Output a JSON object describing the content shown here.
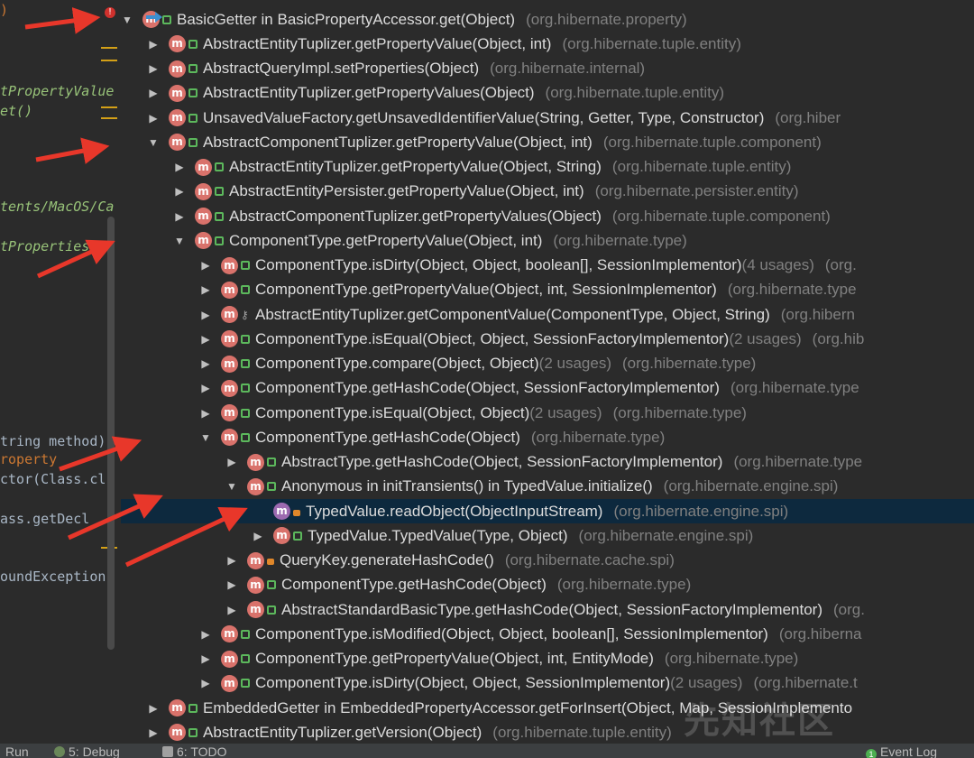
{
  "editor": {
    "lines": [
      {
        "text": ")",
        "cls": "c-orange"
      },
      {
        "text": "tPropertyValue",
        "cls": "c-green"
      },
      {
        "text": "et()",
        "cls": "c-green"
      },
      {
        "text": "tents/MacOS/Ca",
        "cls": "c-green"
      },
      {
        "text": "tProperties",
        "cls": "c-green"
      },
      {
        "text": "tring method)",
        "cls": "c-gray"
      },
      {
        "text": "roperty",
        "cls": "c-orange"
      },
      {
        "text": "ctor(Class.cl",
        "cls": "c-gray"
      },
      {
        "text": "ass.getDecl",
        "cls": "c-gray"
      },
      {
        "text": "oundException",
        "cls": "c-gray"
      }
    ],
    "error_badge": "!"
  },
  "hierarchy": {
    "rows": [
      {
        "label": "BasicGetter in BasicPropertyAccessor.get(Object)",
        "pkg": "(org.hibernate.property)",
        "usage": "",
        "level": 0,
        "arrow": "down",
        "vis": "pub"
      },
      {
        "label": "AbstractEntityTuplizer.getPropertyValue(Object, int)",
        "pkg": "(org.hibernate.tuple.entity)",
        "usage": "",
        "level": 1,
        "arrow": "right",
        "vis": "pub"
      },
      {
        "label": "AbstractQueryImpl.setProperties(Object)",
        "pkg": "(org.hibernate.internal)",
        "usage": "",
        "level": 1,
        "arrow": "right",
        "vis": "pub"
      },
      {
        "label": "AbstractEntityTuplizer.getPropertyValues(Object)",
        "pkg": "(org.hibernate.tuple.entity)",
        "usage": "",
        "level": 1,
        "arrow": "right",
        "vis": "pub"
      },
      {
        "label": "UnsavedValueFactory.getUnsavedIdentifierValue(String, Getter, Type, Constructor)",
        "pkg": "(org.hiber",
        "usage": "",
        "level": 1,
        "arrow": "right",
        "vis": "pub"
      },
      {
        "label": "AbstractComponentTuplizer.getPropertyValue(Object, int)",
        "pkg": "(org.hibernate.tuple.component)",
        "usage": "",
        "level": 1,
        "arrow": "down",
        "vis": "pub"
      },
      {
        "label": "AbstractEntityTuplizer.getPropertyValue(Object, String)",
        "pkg": "(org.hibernate.tuple.entity)",
        "usage": "",
        "level": 2,
        "arrow": "right",
        "vis": "pub"
      },
      {
        "label": "AbstractEntityPersister.getPropertyValue(Object, int)",
        "pkg": "(org.hibernate.persister.entity)",
        "usage": "",
        "level": 2,
        "arrow": "right",
        "vis": "pub"
      },
      {
        "label": "AbstractComponentTuplizer.getPropertyValues(Object)",
        "pkg": "(org.hibernate.tuple.component)",
        "usage": "",
        "level": 2,
        "arrow": "right",
        "vis": "pub"
      },
      {
        "label": "ComponentType.getPropertyValue(Object, int)",
        "pkg": "(org.hibernate.type)",
        "usage": "",
        "level": 2,
        "arrow": "down",
        "vis": "pub"
      },
      {
        "label": "ComponentType.isDirty(Object, Object, boolean[], SessionImplementor)",
        "pkg": "(org.",
        "usage": "(4 usages)",
        "level": 3,
        "arrow": "right",
        "vis": "pub"
      },
      {
        "label": "ComponentType.getPropertyValue(Object, int, SessionImplementor)",
        "pkg": "(org.hibernate.type",
        "usage": "",
        "level": 3,
        "arrow": "right",
        "vis": "pub"
      },
      {
        "label": "AbstractEntityTuplizer.getComponentValue(ComponentType, Object, String)",
        "pkg": "(org.hibern",
        "usage": "",
        "level": 3,
        "arrow": "right",
        "vis": "key"
      },
      {
        "label": "ComponentType.isEqual(Object, Object, SessionFactoryImplementor)",
        "pkg": "(org.hib",
        "usage": "(2 usages)",
        "level": 3,
        "arrow": "right",
        "vis": "pub"
      },
      {
        "label": "ComponentType.compare(Object, Object)",
        "pkg": "(org.hibernate.type)",
        "usage": "(2 usages)",
        "level": 3,
        "arrow": "right",
        "vis": "pub"
      },
      {
        "label": "ComponentType.getHashCode(Object, SessionFactoryImplementor)",
        "pkg": "(org.hibernate.type",
        "usage": "",
        "level": 3,
        "arrow": "right",
        "vis": "pub"
      },
      {
        "label": "ComponentType.isEqual(Object, Object)",
        "pkg": "(org.hibernate.type)",
        "usage": "(2 usages)",
        "level": 3,
        "arrow": "right",
        "vis": "pub"
      },
      {
        "label": "ComponentType.getHashCode(Object)",
        "pkg": "(org.hibernate.type)",
        "usage": "",
        "level": 3,
        "arrow": "down",
        "vis": "pub"
      },
      {
        "label": "AbstractType.getHashCode(Object, SessionFactoryImplementor)",
        "pkg": "(org.hibernate.type",
        "usage": "",
        "level": 4,
        "arrow": "right",
        "vis": "pub"
      },
      {
        "label": "Anonymous in initTransients() in TypedValue.initialize()",
        "pkg": "(org.hibernate.engine.spi)",
        "usage": "",
        "level": 4,
        "arrow": "down",
        "vis": "pub"
      },
      {
        "label": "TypedValue.readObject(ObjectInputStream)",
        "pkg": "(org.hibernate.engine.spi)",
        "usage": "",
        "level": 5,
        "arrow": "none",
        "vis": "lock",
        "selected": true
      },
      {
        "label": "TypedValue.TypedValue(Type, Object)",
        "pkg": "(org.hibernate.engine.spi)",
        "usage": "",
        "level": 5,
        "arrow": "right",
        "vis": "pub"
      },
      {
        "label": "QueryKey.generateHashCode()",
        "pkg": "(org.hibernate.cache.spi)",
        "usage": "",
        "level": 4,
        "arrow": "right",
        "vis": "lock"
      },
      {
        "label": "ComponentType.getHashCode(Object)",
        "pkg": "(org.hibernate.type)",
        "usage": "",
        "level": 4,
        "arrow": "right",
        "vis": "pub"
      },
      {
        "label": "AbstractStandardBasicType.getHashCode(Object, SessionFactoryImplementor)",
        "pkg": "(org.",
        "usage": "",
        "level": 4,
        "arrow": "right",
        "vis": "pub"
      },
      {
        "label": "ComponentType.isModified(Object, Object, boolean[], SessionImplementor)",
        "pkg": "(org.hiberna",
        "usage": "",
        "level": 3,
        "arrow": "right",
        "vis": "pub"
      },
      {
        "label": "ComponentType.getPropertyValue(Object, int, EntityMode)",
        "pkg": "(org.hibernate.type)",
        "usage": "",
        "level": 3,
        "arrow": "right",
        "vis": "pub"
      },
      {
        "label": "ComponentType.isDirty(Object, Object, SessionImplementor)",
        "pkg": "(org.hibernate.t",
        "usage": "(2 usages)",
        "level": 3,
        "arrow": "right",
        "vis": "pub"
      },
      {
        "label": "EmbeddedGetter in EmbeddedPropertyAccessor.getForInsert(Object, Map, SessionImplemento",
        "pkg": "",
        "usage": "",
        "level": 1,
        "arrow": "right",
        "vis": "pub"
      },
      {
        "label": "AbstractEntityTuplizer.getVersion(Object)",
        "pkg": "(org.hibernate.tuple.entity)",
        "usage": "",
        "level": 1,
        "arrow": "right",
        "vis": "pub"
      }
    ],
    "method_badge": "m"
  },
  "watermark": "先知社区",
  "toolbar": {
    "run": "Run",
    "debug": "5: Debug",
    "todo": "6: TODO",
    "event_badge": "1",
    "event_log": "Event Log"
  },
  "colors": {
    "background": "#2b2b2b",
    "selected_row": "#0d293e",
    "method_icon": "#d9726b",
    "annotation_arrow": "#e8372a"
  }
}
